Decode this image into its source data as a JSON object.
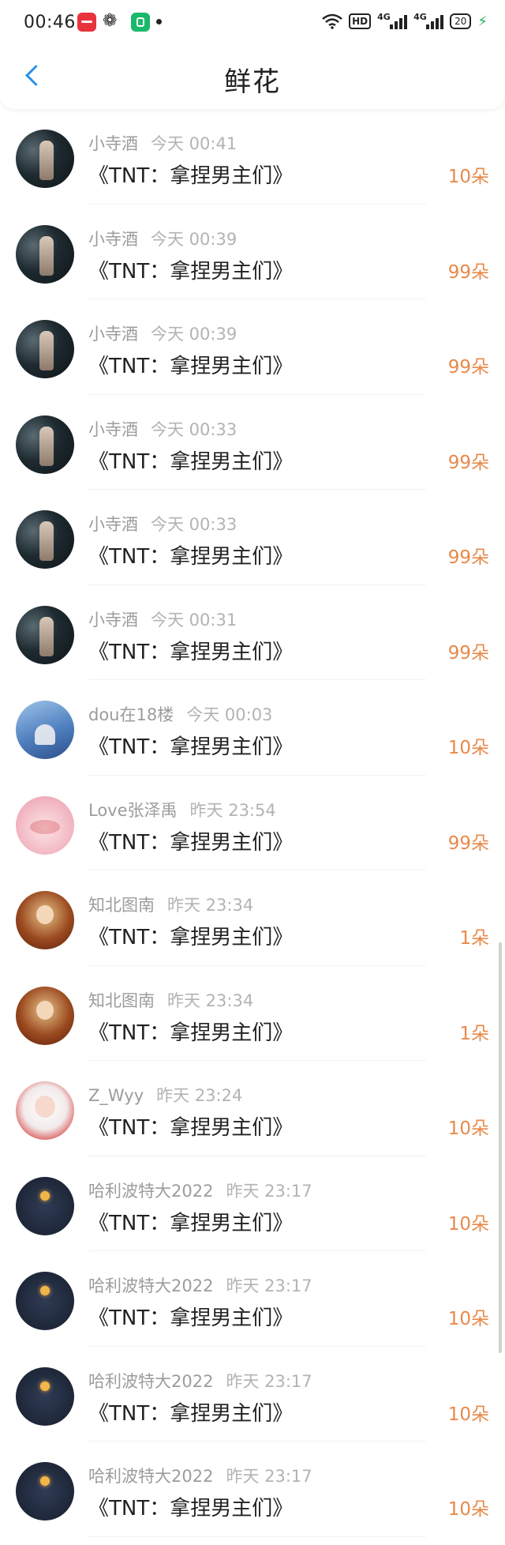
{
  "status_bar": {
    "time": "00:46",
    "weibo_glyph": "❁",
    "hd": "HD",
    "net1": "4G",
    "net2": "4G",
    "battery": "20"
  },
  "header": {
    "title": "鲜花"
  },
  "rows": [
    {
      "user": "小寺酒",
      "time": "今天 00:41",
      "gift": "《TNT：拿捏男主们》",
      "amount": "10朵",
      "avatar": "wine"
    },
    {
      "user": "小寺酒",
      "time": "今天 00:39",
      "gift": "《TNT：拿捏男主们》",
      "amount": "99朵",
      "avatar": "wine"
    },
    {
      "user": "小寺酒",
      "time": "今天 00:39",
      "gift": "《TNT：拿捏男主们》",
      "amount": "99朵",
      "avatar": "wine"
    },
    {
      "user": "小寺酒",
      "time": "今天 00:33",
      "gift": "《TNT：拿捏男主们》",
      "amount": "99朵",
      "avatar": "wine"
    },
    {
      "user": "小寺酒",
      "time": "今天 00:33",
      "gift": "《TNT：拿捏男主们》",
      "amount": "99朵",
      "avatar": "wine"
    },
    {
      "user": "小寺酒",
      "time": "今天 00:31",
      "gift": "《TNT：拿捏男主们》",
      "amount": "99朵",
      "avatar": "wine"
    },
    {
      "user": "dou在18楼",
      "time": "今天 00:03",
      "gift": "《TNT：拿捏男主们》",
      "amount": "10朵",
      "avatar": "dou"
    },
    {
      "user": "Love张泽禹",
      "time": "昨天 23:54",
      "gift": "《TNT：拿捏男主们》",
      "amount": "99朵",
      "avatar": "love"
    },
    {
      "user": "知北图南",
      "time": "昨天 23:34",
      "gift": "《TNT：拿捏男主们》",
      "amount": "1朵",
      "avatar": "zhibei"
    },
    {
      "user": "知北图南",
      "time": "昨天 23:34",
      "gift": "《TNT：拿捏男主们》",
      "amount": "1朵",
      "avatar": "zhibei"
    },
    {
      "user": "Z_Wyy",
      "time": "昨天 23:24",
      "gift": "《TNT：拿捏男主们》",
      "amount": "10朵",
      "avatar": "zwyy"
    },
    {
      "user": "哈利波特大2022",
      "time": "昨天 23:17",
      "gift": "《TNT：拿捏男主们》",
      "amount": "10朵",
      "avatar": "hali"
    },
    {
      "user": "哈利波特大2022",
      "time": "昨天 23:17",
      "gift": "《TNT：拿捏男主们》",
      "amount": "10朵",
      "avatar": "hali"
    },
    {
      "user": "哈利波特大2022",
      "time": "昨天 23:17",
      "gift": "《TNT：拿捏男主们》",
      "amount": "10朵",
      "avatar": "hali"
    },
    {
      "user": "哈利波特大2022",
      "time": "昨天 23:17",
      "gift": "《TNT：拿捏男主们》",
      "amount": "10朵",
      "avatar": "hali"
    }
  ]
}
